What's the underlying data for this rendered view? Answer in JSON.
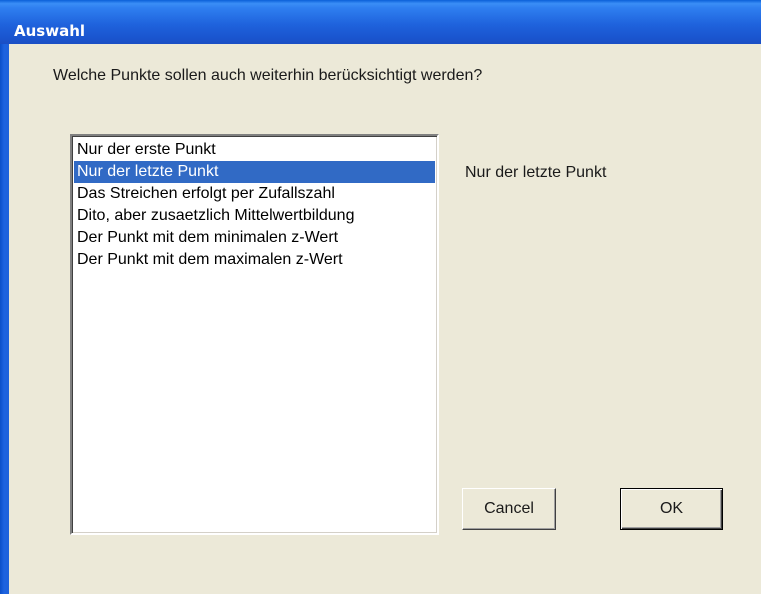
{
  "window": {
    "title": "Auswahl"
  },
  "dialog": {
    "question": "Welche Punkte sollen auch weiterhin berücksichtigt werden?",
    "options": [
      "Nur der erste Punkt",
      "Nur der letzte Punkt",
      "Das Streichen erfolgt per Zufallszahl",
      "Dito, aber zusaetzlich Mittelwertbildung",
      "Der Punkt mit dem minimalen z-Wert",
      "Der Punkt mit dem maximalen z-Wert"
    ],
    "selected_index": 1,
    "selected_label": "Nur der letzte Punkt",
    "cancel_label": "Cancel",
    "ok_label": "OK"
  },
  "colors": {
    "titlebar": "#2f7ff0",
    "selection": "#316ac5",
    "dialog_background": "#ece9d8"
  }
}
